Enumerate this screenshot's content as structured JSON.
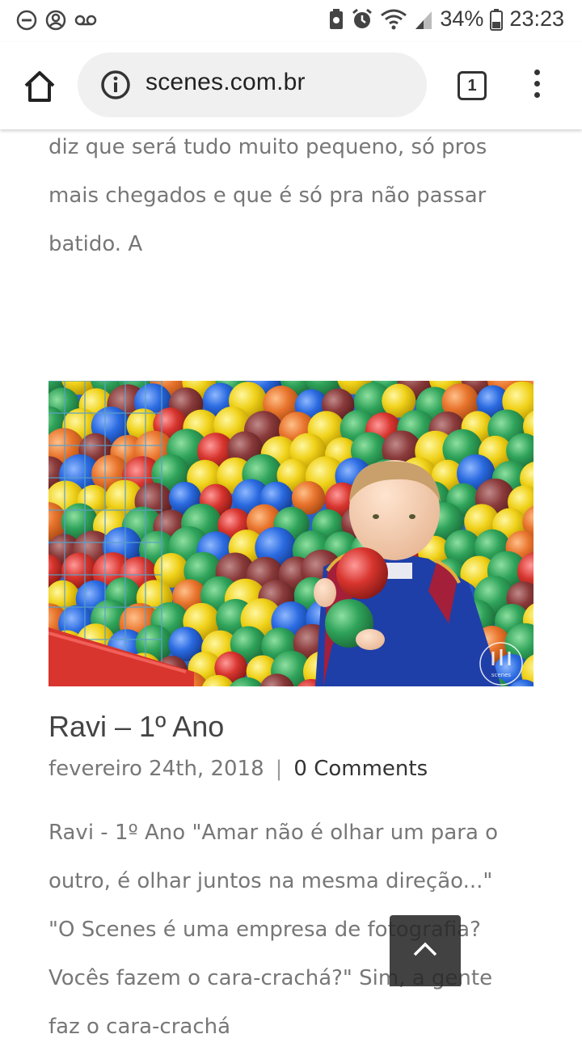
{
  "status_bar": {
    "battery": "34%",
    "time": "23:23"
  },
  "browser": {
    "url": "scenes.com.br",
    "tab_count": "1"
  },
  "article": {
    "intro_lines": [
      "diz que será tudo muito pequeno, só pros",
      "mais chegados e que é só  pra não passar",
      "batido. A"
    ],
    "post": {
      "title": "Ravi – 1º Ano",
      "date": "fevereiro 24th, 2018",
      "separator": "|",
      "comments": "0 Comments",
      "excerpt_lines": [
        "Ravi - 1º Ano \"Amar não é olhar um para o",
        "outro, é olhar juntos na mesma direção...\"",
        "\"O Scenes é uma empresa de fotografia?",
        "Vocês fazem o cara-crachá?\" Sim, a gente",
        "faz o cara-crachá"
      ],
      "image_watermark": "scenes"
    }
  },
  "colors": {
    "text": "#777777",
    "title": "#444444",
    "accent_red": "#d8352e"
  }
}
